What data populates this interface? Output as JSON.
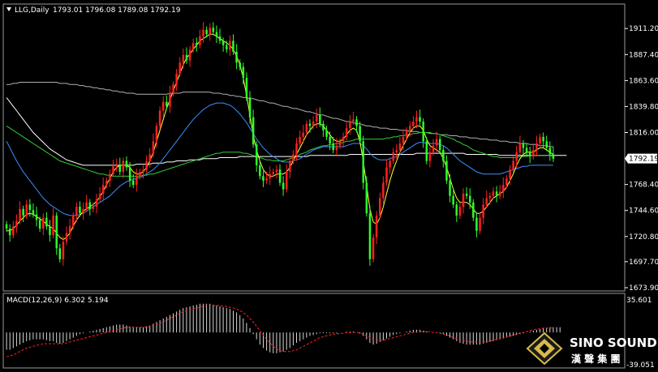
{
  "header": {
    "symbol_label": "LLG,Daily",
    "ohlc_label": "1793.01 1796.08 1789.08 1792.19"
  },
  "indicator": {
    "label": "MACD(12,26,9) 6.302 5.194",
    "ticks": [
      "35.601",
      "-39.051"
    ],
    "range": [
      -39.051,
      35.601
    ]
  },
  "price_axis": {
    "ticks": [
      "1911.20",
      "1887.40",
      "1863.60",
      "1839.80",
      "1816.00",
      "1768.40",
      "1744.60",
      "1720.80",
      "1697.70",
      "1673.90"
    ],
    "tick_values": [
      1911.2,
      1887.4,
      1863.6,
      1839.8,
      1816.0,
      1768.4,
      1744.6,
      1720.8,
      1697.7,
      1673.9
    ],
    "current_price": "1792.19",
    "current_value": 1792.19,
    "range": [
      1673.9,
      1921.0
    ]
  },
  "logo": {
    "name": "SINO SOUND",
    "chinese": "漢 聲 集 團"
  },
  "colors": {
    "background": "#000000",
    "bull": "#ffffff",
    "bear": "#00ff00",
    "up_candle": "#ff2020",
    "down_candle": "#2cff2c",
    "ma_fast": "#ffff33",
    "ma_blue": "#3a8fff",
    "ma_green": "#33cc33",
    "ma_white": "#ffffff",
    "ma_grey": "#b0b0b0",
    "macd_hist": "#d8d8d8",
    "macd_signal": "#ff2020",
    "current_price_bg": "#ffffff"
  },
  "chart_data": {
    "type": "candlestick",
    "title": "LLG,Daily",
    "closes": [
      1728,
      1722,
      1730,
      1735,
      1746,
      1740,
      1750,
      1745,
      1741,
      1736,
      1728,
      1738,
      1730,
      1722,
      1740,
      1710,
      1700,
      1716,
      1724,
      1730,
      1740,
      1748,
      1742,
      1746,
      1752,
      1746,
      1748,
      1755,
      1760,
      1768,
      1772,
      1778,
      1786,
      1786,
      1780,
      1790,
      1784,
      1772,
      1768,
      1776,
      1780,
      1782,
      1790,
      1796,
      1808,
      1822,
      1836,
      1844,
      1840,
      1852,
      1860,
      1870,
      1880,
      1887,
      1882,
      1892,
      1898,
      1896,
      1904,
      1910,
      1906,
      1912,
      1908,
      1904,
      1900,
      1896,
      1892,
      1900,
      1890,
      1880,
      1876,
      1866,
      1848,
      1830,
      1805,
      1786,
      1776,
      1772,
      1774,
      1778,
      1780,
      1782,
      1770,
      1764,
      1780,
      1790,
      1796,
      1806,
      1812,
      1816,
      1824,
      1822,
      1826,
      1832,
      1824,
      1818,
      1812,
      1806,
      1800,
      1804,
      1808,
      1812,
      1820,
      1826,
      1828,
      1822,
      1808,
      1770,
      1742,
      1700,
      1720,
      1740,
      1756,
      1770,
      1784,
      1790,
      1798,
      1800,
      1806,
      1812,
      1818,
      1822,
      1826,
      1830,
      1826,
      1808,
      1790,
      1798,
      1804,
      1810,
      1800,
      1790,
      1772,
      1758,
      1750,
      1740,
      1748,
      1760,
      1758,
      1752,
      1738,
      1726,
      1738,
      1750,
      1756,
      1758,
      1762,
      1758,
      1762,
      1768,
      1774,
      1782,
      1790,
      1798,
      1806,
      1802,
      1798,
      1794,
      1800,
      1806,
      1812,
      1808,
      1802,
      1796,
      1792
    ],
    "ma_fast": [
      1726,
      1726,
      1728,
      1731,
      1735,
      1738,
      1741,
      1742,
      1741,
      1739,
      1737,
      1735,
      1732,
      1730,
      1728,
      1724,
      1720,
      1718,
      1720,
      1724,
      1730,
      1736,
      1740,
      1744,
      1746,
      1748,
      1750,
      1753,
      1757,
      1762,
      1768,
      1774,
      1780,
      1784,
      1786,
      1786,
      1786,
      1784,
      1780,
      1778,
      1778,
      1780,
      1784,
      1790,
      1798,
      1808,
      1818,
      1828,
      1838,
      1846,
      1854,
      1862,
      1870,
      1878,
      1884,
      1888,
      1892,
      1896,
      1900,
      1902,
      1904,
      1906,
      1906,
      1904,
      1902,
      1900,
      1898,
      1896,
      1892,
      1886,
      1878,
      1866,
      1850,
      1832,
      1814,
      1800,
      1790,
      1782,
      1778,
      1776,
      1776,
      1778,
      1778,
      1778,
      1780,
      1784,
      1790,
      1796,
      1802,
      1808,
      1814,
      1818,
      1822,
      1824,
      1824,
      1822,
      1818,
      1814,
      1810,
      1808,
      1808,
      1810,
      1814,
      1818,
      1820,
      1818,
      1808,
      1790,
      1768,
      1746,
      1734,
      1732,
      1738,
      1748,
      1760,
      1772,
      1782,
      1790,
      1798,
      1804,
      1810,
      1816,
      1820,
      1822,
      1822,
      1818,
      1810,
      1804,
      1802,
      1800,
      1798,
      1792,
      1784,
      1774,
      1764,
      1756,
      1752,
      1752,
      1752,
      1750,
      1746,
      1742,
      1742,
      1744,
      1748,
      1752,
      1756,
      1758,
      1760,
      1762,
      1766,
      1772,
      1778,
      1786,
      1792,
      1796,
      1798,
      1798,
      1798,
      1800,
      1802,
      1802,
      1800,
      1798,
      1796
    ],
    "ma_blue": [
      1808,
      1802,
      1796,
      1790,
      1785,
      1780,
      1776,
      1772,
      1768,
      1764,
      1760,
      1756,
      1753,
      1750,
      1748,
      1746,
      1744,
      1742,
      1741,
      1740,
      1740,
      1740,
      1741,
      1742,
      1744,
      1746,
      1748,
      1750,
      1752,
      1754,
      1756,
      1758,
      1761,
      1764,
      1767,
      1769,
      1771,
      1772,
      1773,
      1774,
      1775,
      1776,
      1778,
      1780,
      1782,
      1785,
      1788,
      1792,
      1796,
      1800,
      1804,
      1808,
      1812,
      1816,
      1820,
      1824,
      1828,
      1831,
      1834,
      1837,
      1839,
      1841,
      1842,
      1843,
      1843,
      1843,
      1842,
      1841,
      1839,
      1836,
      1833,
      1829,
      1825,
      1820,
      1815,
      1810,
      1806,
      1802,
      1799,
      1796,
      1794,
      1792,
      1790,
      1789,
      1789,
      1789,
      1790,
      1791,
      1792,
      1794,
      1796,
      1798,
      1800,
      1801,
      1802,
      1803,
      1803,
      1803,
      1803,
      1803,
      1803,
      1803,
      1804,
      1805,
      1806,
      1806,
      1806,
      1804,
      1801,
      1797,
      1794,
      1792,
      1791,
      1791,
      1791,
      1792,
      1793,
      1794,
      1796,
      1798,
      1800,
      1802,
      1804,
      1806,
      1807,
      1807,
      1806,
      1806,
      1806,
      1806,
      1805,
      1804,
      1802,
      1799,
      1796,
      1793,
      1790,
      1788,
      1786,
      1784,
      1782,
      1780,
      1779,
      1778,
      1778,
      1778,
      1778,
      1778,
      1778,
      1779,
      1780,
      1781,
      1782,
      1783,
      1784,
      1785,
      1785,
      1786,
      1786,
      1786,
      1786,
      1786,
      1786,
      1786,
      1786
    ],
    "ma_green": [
      1822,
      1820,
      1818,
      1816,
      1814,
      1812,
      1810,
      1808,
      1806,
      1804,
      1802,
      1800,
      1798,
      1796,
      1794,
      1792,
      1790,
      1789,
      1788,
      1787,
      1786,
      1785,
      1784,
      1783,
      1782,
      1781,
      1780,
      1779,
      1778,
      1778,
      1777,
      1777,
      1776,
      1776,
      1776,
      1776,
      1776,
      1776,
      1776,
      1776,
      1776,
      1777,
      1777,
      1778,
      1778,
      1779,
      1780,
      1781,
      1782,
      1783,
      1784,
      1785,
      1786,
      1787,
      1788,
      1789,
      1790,
      1791,
      1792,
      1793,
      1794,
      1795,
      1796,
      1797,
      1797,
      1798,
      1798,
      1798,
      1798,
      1798,
      1798,
      1797,
      1797,
      1796,
      1795,
      1794,
      1793,
      1792,
      1791,
      1791,
      1790,
      1790,
      1790,
      1790,
      1791,
      1792,
      1793,
      1794,
      1796,
      1797,
      1798,
      1800,
      1801,
      1802,
      1803,
      1804,
      1804,
      1805,
      1805,
      1806,
      1806,
      1807,
      1808,
      1808,
      1809,
      1810,
      1810,
      1810,
      1810,
      1810,
      1810,
      1810,
      1810,
      1810,
      1811,
      1811,
      1812,
      1812,
      1813,
      1813,
      1814,
      1814,
      1815,
      1815,
      1816,
      1816,
      1816,
      1816,
      1815,
      1815,
      1814,
      1813,
      1812,
      1811,
      1810,
      1808,
      1807,
      1805,
      1804,
      1802,
      1800,
      1799,
      1798,
      1797,
      1796,
      1795,
      1794,
      1794,
      1793,
      1793,
      1793,
      1793,
      1793,
      1793,
      1794,
      1794,
      1794,
      1795,
      1795,
      1795,
      1795,
      1795,
      1795,
      1795,
      1794
    ],
    "ma_white": [
      1848,
      1844,
      1840,
      1836,
      1832,
      1828,
      1824,
      1820,
      1816,
      1813,
      1810,
      1807,
      1804,
      1801,
      1799,
      1797,
      1795,
      1793,
      1791,
      1790,
      1789,
      1788,
      1787,
      1786,
      1786,
      1786,
      1786,
      1786,
      1786,
      1786,
      1786,
      1786,
      1786,
      1786,
      1786,
      1786,
      1786,
      1786,
      1786,
      1787,
      1787,
      1787,
      1787,
      1787,
      1788,
      1788,
      1788,
      1788,
      1789,
      1789,
      1789,
      1790,
      1790,
      1790,
      1790,
      1791,
      1791,
      1791,
      1791,
      1792,
      1792,
      1792,
      1792,
      1792,
      1793,
      1793,
      1793,
      1793,
      1793,
      1793,
      1794,
      1794,
      1794,
      1794,
      1794,
      1794,
      1794,
      1794,
      1794,
      1794,
      1794,
      1794,
      1794,
      1794,
      1794,
      1794,
      1794,
      1794,
      1794,
      1794,
      1794,
      1795,
      1795,
      1795,
      1795,
      1795,
      1795,
      1795,
      1795,
      1795,
      1795,
      1795,
      1795,
      1796,
      1796,
      1796,
      1796,
      1796,
      1796,
      1796,
      1796,
      1796,
      1796,
      1796,
      1796,
      1796,
      1796,
      1796,
      1796,
      1796,
      1796,
      1796,
      1796,
      1797,
      1797,
      1797,
      1797,
      1797,
      1797,
      1797,
      1797,
      1797,
      1797,
      1797,
      1797,
      1797,
      1797,
      1797,
      1796,
      1796,
      1796,
      1796,
      1796,
      1796,
      1796,
      1796,
      1796,
      1796,
      1795,
      1795,
      1795,
      1795,
      1795,
      1795,
      1795,
      1795,
      1795,
      1795,
      1795,
      1795,
      1795,
      1795,
      1795,
      1795,
      1795,
      1795,
      1795,
      1795,
      1795
    ],
    "ma_grey": [
      1860,
      1860,
      1861,
      1861,
      1862,
      1862,
      1862,
      1862,
      1862,
      1862,
      1862,
      1862,
      1862,
      1862,
      1862,
      1862,
      1861,
      1861,
      1861,
      1860,
      1860,
      1860,
      1859,
      1859,
      1858,
      1858,
      1857,
      1857,
      1856,
      1856,
      1855,
      1855,
      1854,
      1854,
      1853,
      1853,
      1852,
      1852,
      1852,
      1851,
      1851,
      1851,
      1851,
      1851,
      1851,
      1851,
      1851,
      1851,
      1851,
      1852,
      1852,
      1852,
      1852,
      1853,
      1853,
      1853,
      1853,
      1853,
      1853,
      1853,
      1853,
      1853,
      1852,
      1852,
      1852,
      1851,
      1851,
      1850,
      1850,
      1849,
      1849,
      1848,
      1848,
      1847,
      1847,
      1846,
      1845,
      1845,
      1844,
      1843,
      1843,
      1842,
      1841,
      1840,
      1840,
      1839,
      1838,
      1838,
      1837,
      1836,
      1835,
      1835,
      1834,
      1833,
      1832,
      1832,
      1831,
      1830,
      1829,
      1829,
      1828,
      1827,
      1826,
      1826,
      1825,
      1824,
      1824,
      1823,
      1822,
      1822,
      1821,
      1821,
      1820,
      1820,
      1820,
      1819,
      1819,
      1819,
      1818,
      1818,
      1818,
      1817,
      1817,
      1817,
      1816,
      1816,
      1816,
      1815,
      1815,
      1815,
      1814,
      1814,
      1814,
      1813,
      1813,
      1813,
      1812,
      1812,
      1812,
      1811,
      1811,
      1811,
      1810,
      1810,
      1810,
      1809,
      1809,
      1809,
      1808,
      1808,
      1808,
      1807,
      1807,
      1807,
      1806,
      1806,
      1806,
      1805,
      1805,
      1805,
      1804,
      1804,
      1804,
      1803,
      1803
    ],
    "macd_hist": [
      -20,
      -20,
      -18,
      -16,
      -14,
      -12,
      -10,
      -9,
      -8,
      -8,
      -8,
      -8,
      -9,
      -10,
      -10,
      -12,
      -13,
      -12,
      -10,
      -8,
      -6,
      -4,
      -2,
      -1,
      0,
      1,
      2,
      3,
      4,
      5,
      6,
      7,
      8,
      9,
      9,
      9,
      8,
      7,
      6,
      6,
      6,
      6,
      7,
      8,
      10,
      12,
      14,
      16,
      18,
      20,
      22,
      24,
      26,
      28,
      29,
      30,
      31,
      32,
      33,
      33,
      33,
      33,
      32,
      31,
      30,
      29,
      28,
      27,
      25,
      23,
      20,
      16,
      11,
      5,
      -2,
      -8,
      -14,
      -18,
      -21,
      -23,
      -24,
      -24,
      -23,
      -22,
      -20,
      -18,
      -15,
      -12,
      -10,
      -8,
      -6,
      -4,
      -3,
      -2,
      -1,
      -1,
      -1,
      -1,
      -1,
      -1,
      0,
      0,
      1,
      1,
      1,
      0,
      -1,
      -4,
      -8,
      -12,
      -14,
      -13,
      -11,
      -9,
      -7,
      -5,
      -3,
      -2,
      -1,
      0,
      1,
      2,
      3,
      3,
      3,
      2,
      1,
      0,
      0,
      0,
      -1,
      -2,
      -4,
      -6,
      -8,
      -10,
      -12,
      -13,
      -14,
      -14,
      -14,
      -14,
      -14,
      -13,
      -12,
      -11,
      -10,
      -9,
      -8,
      -7,
      -6,
      -5,
      -4,
      -3,
      -2,
      -1,
      0,
      1,
      2,
      3,
      4,
      5,
      5,
      6,
      6,
      6,
      6
    ],
    "macd_signal": [
      -28,
      -27,
      -26,
      -24,
      -22,
      -20,
      -18,
      -17,
      -16,
      -15,
      -14,
      -13,
      -13,
      -13,
      -13,
      -13,
      -13,
      -13,
      -12,
      -11,
      -10,
      -9,
      -8,
      -7,
      -6,
      -5,
      -4,
      -3,
      -2,
      -1,
      0,
      1,
      2,
      3,
      4,
      5,
      6,
      6,
      6,
      6,
      6,
      6,
      6,
      7,
      8,
      9,
      10,
      12,
      14,
      16,
      18,
      20,
      22,
      24,
      25,
      26,
      27,
      28,
      29,
      30,
      31,
      31,
      31,
      31,
      31,
      30,
      30,
      29,
      28,
      27,
      25,
      23,
      20,
      16,
      12,
      7,
      2,
      -3,
      -8,
      -12,
      -16,
      -19,
      -21,
      -22,
      -22,
      -22,
      -21,
      -20,
      -18,
      -16,
      -14,
      -12,
      -10,
      -8,
      -6,
      -5,
      -4,
      -3,
      -2,
      -2,
      -1,
      -1,
      0,
      0,
      0,
      0,
      -1,
      -2,
      -4,
      -6,
      -8,
      -9,
      -9,
      -9,
      -8,
      -7,
      -6,
      -5,
      -4,
      -3,
      -2,
      -1,
      0,
      1,
      1,
      1,
      1,
      1,
      0,
      0,
      -1,
      -2,
      -3,
      -4,
      -6,
      -7,
      -8,
      -9,
      -10,
      -11,
      -11,
      -11,
      -11,
      -11,
      -10,
      -10,
      -9,
      -8,
      -7,
      -6,
      -5,
      -4,
      -3,
      -2,
      -1,
      0,
      1,
      2,
      3,
      4,
      4,
      5,
      5,
      5,
      5
    ]
  }
}
